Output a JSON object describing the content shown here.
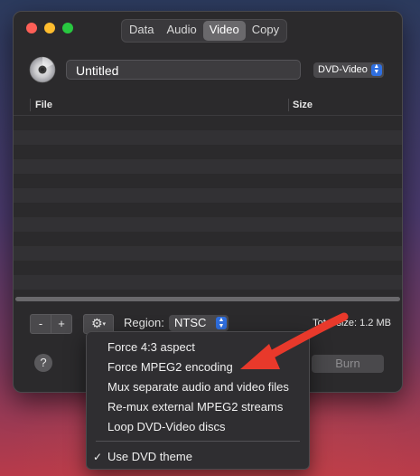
{
  "tabs": [
    {
      "label": "Data"
    },
    {
      "label": "Audio"
    },
    {
      "label": "Video"
    },
    {
      "label": "Copy"
    }
  ],
  "disc": {
    "title": "Untitled",
    "format": "DVD-Video"
  },
  "table": {
    "columns": [
      "File",
      "Size"
    ],
    "rows": []
  },
  "toolbar": {
    "minus_label": "-",
    "plus_label": "+",
    "gear_icon": "gear-icon",
    "region_label": "Region:",
    "region_value": "NTSC",
    "total_size": "Total size: 1.2 MB"
  },
  "footer": {
    "help_label": "?",
    "burn_label": "Burn"
  },
  "menu": {
    "items": [
      {
        "label": "Force 4:3 aspect"
      },
      {
        "label": "Force MPEG2 encoding"
      },
      {
        "label": "Mux separate audio and video files"
      },
      {
        "label": "Re-mux external MPEG2 streams"
      },
      {
        "label": "Loop DVD-Video discs"
      }
    ],
    "checked_item": {
      "label": "Use DVD theme",
      "check": "✓"
    }
  },
  "colors": {
    "accent": "#2f6fe0",
    "annotation_arrow": "#e8392b"
  }
}
